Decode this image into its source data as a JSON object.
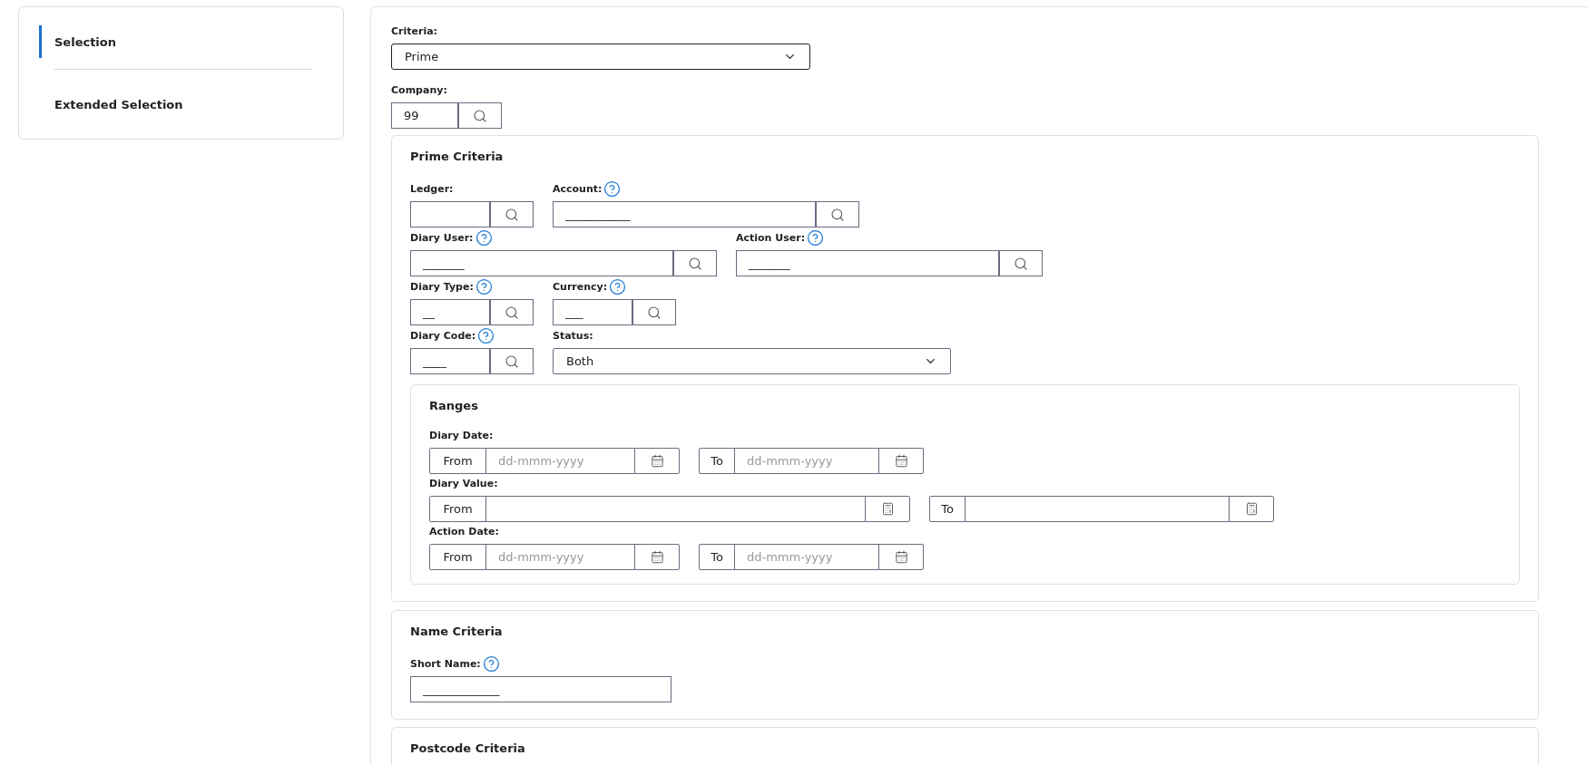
{
  "sidebar": {
    "items": [
      {
        "label": "Selection",
        "selected": true
      },
      {
        "label": "Extended Selection",
        "selected": false
      }
    ]
  },
  "criteria": {
    "label": "Criteria:",
    "value": "Prime"
  },
  "company": {
    "label": "Company:",
    "value": "99"
  },
  "prime_criteria": {
    "title": "Prime Criteria",
    "rows": [
      [
        {
          "label": "Ledger:",
          "help": false,
          "kind": "code"
        },
        {
          "label": "Account:",
          "help": true,
          "kind": "lookup",
          "value": "___________"
        }
      ],
      [
        {
          "label": "Diary User:",
          "help": true,
          "kind": "lookup",
          "value": "_______"
        },
        {
          "label": "Action User:",
          "help": true,
          "kind": "lookup",
          "value": "_______"
        }
      ],
      [
        {
          "label": "Diary Type:",
          "help": true,
          "kind": "code",
          "value": "__"
        },
        {
          "label": "Currency:",
          "help": true,
          "kind": "code",
          "value": "___"
        }
      ],
      [
        {
          "label": "Diary Code:",
          "help": true,
          "kind": "code",
          "value": "____"
        },
        {
          "label": "Status:",
          "help": false,
          "kind": "select",
          "value": "Both"
        }
      ]
    ],
    "ranges": {
      "title": "Ranges",
      "rows": [
        {
          "label": "Diary Date:",
          "kind": "date",
          "from": {
            "label": "From",
            "placeholder": "dd-mmm-yyyy"
          },
          "to": {
            "label": "To",
            "placeholder": "dd-mmm-yyyy"
          }
        },
        {
          "label": "Diary Value:",
          "kind": "number",
          "from": {
            "label": "From"
          },
          "to": {
            "label": "To"
          }
        },
        {
          "label": "Action Date:",
          "kind": "date",
          "from": {
            "label": "From",
            "placeholder": "dd-mmm-yyyy"
          },
          "to": {
            "label": "To",
            "placeholder": "dd-mmm-yyyy"
          }
        }
      ]
    }
  },
  "name_criteria": {
    "title": "Name Criteria",
    "fields": [
      {
        "label": "Short Name:",
        "help": true,
        "value": "_____________"
      }
    ]
  },
  "postcode_criteria": {
    "title": "Postcode Criteria"
  }
}
